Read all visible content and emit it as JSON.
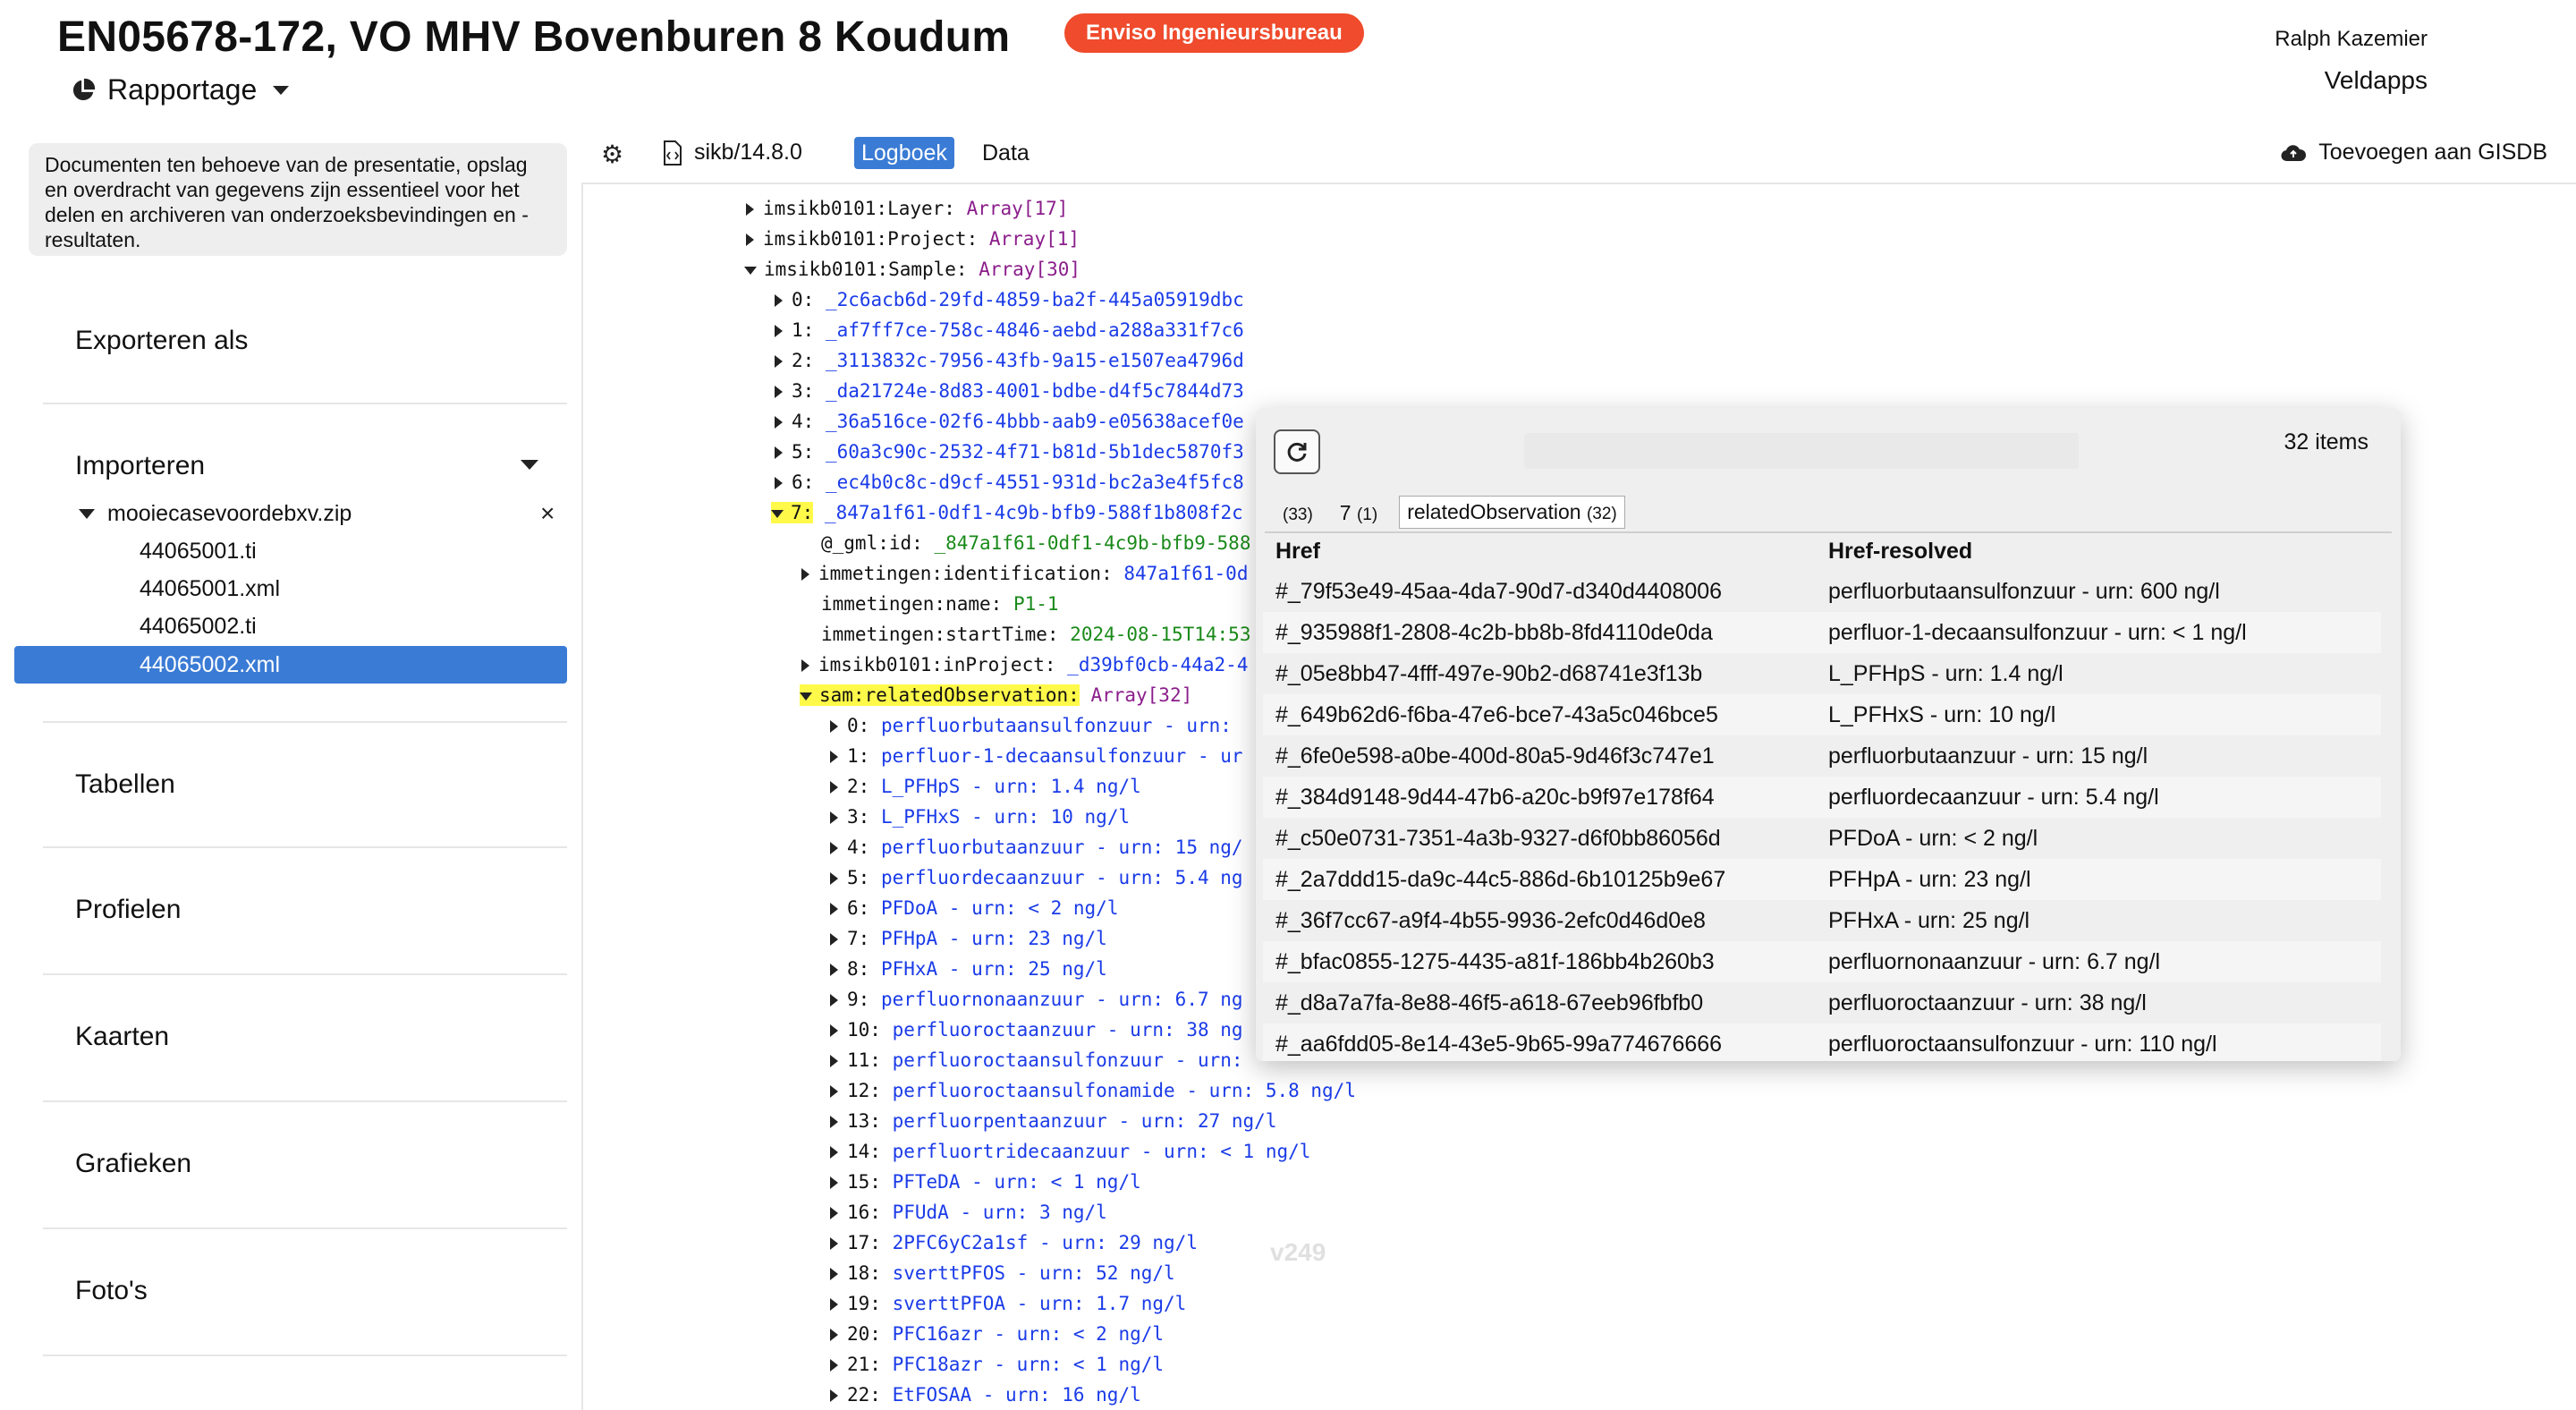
{
  "header": {
    "title": "EN05678-172, VO MHV Bovenburen 8 Koudum",
    "badge": "Enviso Ingenieursbureau",
    "menu_label": "Rapportage",
    "user": "Ralph Kazemier",
    "app": "Veldapps"
  },
  "sidebar": {
    "description": "Documenten ten behoeve van de presentatie, opslag en overdracht van gegevens zijn essentieel voor het delen en archiveren van onderzoeksbevindingen en -resultaten.",
    "export_label": "Exporteren als",
    "import_label": "Importeren",
    "zip_name": "mooiecasevoordebxv.zip",
    "files": [
      "44065001.ti",
      "44065001.xml",
      "44065002.ti",
      "44065002.xml"
    ],
    "selected_file": "44065002.xml",
    "sections": [
      "Tabellen",
      "Profielen",
      "Kaarten",
      "Grafieken",
      "Foto's"
    ]
  },
  "toolbar": {
    "file_label": "sikb/14.8.0",
    "tab_active": "Logboek",
    "tab_data": "Data",
    "gisdb_label": "Toevoegen aan GISDB"
  },
  "tree": {
    "layer_key": "imsikb0101:Layer:",
    "layer_val": "Array[17]",
    "project_key": "imsikb0101:Project:",
    "project_val": "Array[1]",
    "sample_key": "imsikb0101:Sample:",
    "sample_val": "Array[30]",
    "samples": [
      {
        "k": "0:",
        "v": "_2c6acb6d-29fd-4859-ba2f-445a05919dbc"
      },
      {
        "k": "1:",
        "v": "_af7ff7ce-758c-4846-aebd-a288a331f7c6"
      },
      {
        "k": "2:",
        "v": "_3113832c-7956-43fb-9a15-e1507ea4796d"
      },
      {
        "k": "3:",
        "v": "_da21724e-8d83-4001-bdbe-d4f5c7844d73"
      },
      {
        "k": "4:",
        "v": "_36a516ce-02f6-4bbb-aab9-e05638acef0e"
      },
      {
        "k": "5:",
        "v": "_60a3c90c-2532-4f71-b81d-5b1dec5870f3"
      },
      {
        "k": "6:",
        "v": "_ec4b0c8c-d9cf-4551-931d-bc2a3e4f5fc8"
      }
    ],
    "sel_key": "7:",
    "sel_val": "_847a1f61-0df1-4c9b-bfb9-588f1b808f2c",
    "gml_key": "@_gml:id:",
    "gml_val": "_847a1f61-0df1-4c9b-bfb9-588",
    "ident_key": "immetingen:identification:",
    "ident_val": "847a1f61-0d",
    "name_key": "immetingen:name:",
    "name_val": "P1-1",
    "start_key": "immetingen:startTime:",
    "start_val": "2024-08-15T14:53",
    "inproj_key": "imsikb0101:inProject:",
    "inproj_val": "_d39bf0cb-44a2-4",
    "related_key": "sam:relatedObservation:",
    "related_val": "Array[32]",
    "observations": [
      {
        "k": "0:",
        "v": "perfluorbutaansulfonzuur - urn:"
      },
      {
        "k": "1:",
        "v": "perfluor-1-decaansulfonzuur - ur"
      },
      {
        "k": "2:",
        "v": "L_PFHpS - urn: 1.4 ng/l"
      },
      {
        "k": "3:",
        "v": "L_PFHxS - urn: 10 ng/l"
      },
      {
        "k": "4:",
        "v": "perfluorbutaanzuur - urn: 15 ng/"
      },
      {
        "k": "5:",
        "v": "perfluordecaanzuur - urn: 5.4 ng"
      },
      {
        "k": "6:",
        "v": "PFDoA - urn: < 2 ng/l"
      },
      {
        "k": "7:",
        "v": "PFHpA - urn: 23 ng/l"
      },
      {
        "k": "8:",
        "v": "PFHxA - urn: 25 ng/l"
      },
      {
        "k": "9:",
        "v": "perfluornonaanzuur - urn: 6.7 ng"
      },
      {
        "k": "10:",
        "v": "perfluoroctaanzuur - urn: 38 ng"
      },
      {
        "k": "11:",
        "v": "perfluoroctaansulfonzuur - urn:"
      },
      {
        "k": "12:",
        "v": "perfluoroctaansulfonamide - urn: 5.8 ng/l"
      },
      {
        "k": "13:",
        "v": "perfluorpentaanzuur - urn: 27 ng/l"
      },
      {
        "k": "14:",
        "v": "perfluortridecaanzuur - urn: < 1 ng/l"
      },
      {
        "k": "15:",
        "v": "PFTeDA - urn: < 1 ng/l"
      },
      {
        "k": "16:",
        "v": "PFUdA - urn: 3 ng/l"
      },
      {
        "k": "17:",
        "v": "2PFC6yC2a1sf - urn: 29 ng/l"
      },
      {
        "k": "18:",
        "v": "sverttPFOS - urn: 52 ng/l"
      },
      {
        "k": "19:",
        "v": "sverttPFOA - urn: 1.7 ng/l"
      },
      {
        "k": "20:",
        "v": "PFC16azr - urn: < 2 ng/l"
      },
      {
        "k": "21:",
        "v": "PFC18azr - urn: < 1 ng/l"
      },
      {
        "k": "22:",
        "v": "EtFOSAA - urn: 16 ng/l"
      }
    ]
  },
  "popup": {
    "count": "32 items",
    "tabs": [
      {
        "label": "",
        "count": "(33)"
      },
      {
        "label": "7",
        "count": "(1)"
      },
      {
        "label": "relatedObservation",
        "count": "(32)"
      }
    ],
    "col_href": "Href",
    "col_resolved": "Href-resolved",
    "rows": [
      {
        "href": "#_79f53e49-45aa-4da7-90d7-d340d4408006",
        "resolved": "perfluorbutaansulfonzuur - urn: 600 ng/l"
      },
      {
        "href": "#_935988f1-2808-4c2b-bb8b-8fd4110de0da",
        "resolved": "perfluor-1-decaansulfonzuur - urn: < 1 ng/l"
      },
      {
        "href": "#_05e8bb47-4fff-497e-90b2-d68741e3f13b",
        "resolved": "L_PFHpS - urn: 1.4 ng/l"
      },
      {
        "href": "#_649b62d6-f6ba-47e6-bce7-43a5c046bce5",
        "resolved": "L_PFHxS - urn: 10 ng/l"
      },
      {
        "href": "#_6fe0e598-a0be-400d-80a5-9d46f3c747e1",
        "resolved": "perfluorbutaanzuur - urn: 15 ng/l"
      },
      {
        "href": "#_384d9148-9d44-47b6-a20c-b9f97e178f64",
        "resolved": "perfluordecaanzuur - urn: 5.4 ng/l"
      },
      {
        "href": "#_c50e0731-7351-4a3b-9327-d6f0bb86056d",
        "resolved": "PFDoA - urn: < 2 ng/l"
      },
      {
        "href": "#_2a7ddd15-da9c-44c5-886d-6b10125b9e67",
        "resolved": "PFHpA - urn: 23 ng/l"
      },
      {
        "href": "#_36f7cc67-a9f4-4b55-9936-2efc0d46d0e8",
        "resolved": "PFHxA - urn: 25 ng/l"
      },
      {
        "href": "#_bfac0855-1275-4435-a81f-186bb4b260b3",
        "resolved": "perfluornonaanzuur - urn: 6.7 ng/l"
      },
      {
        "href": "#_d8a7a7fa-8e88-46f5-a618-67eeb96fbfb0",
        "resolved": "perfluoroctaanzuur - urn: 38 ng/l"
      },
      {
        "href": "#_aa6fdd05-8e14-43e5-9b65-99a774676666",
        "resolved": "perfluoroctaansulfonzuur - urn: 110 ng/l"
      }
    ]
  },
  "version": "v249",
  "colors": {
    "accent": "#3a7bd5",
    "badge": "#ef4b2c",
    "highlight": "#fff94a",
    "link": "#1a3be8",
    "array": "#8b1d8b",
    "string": "#1a8a1a"
  }
}
